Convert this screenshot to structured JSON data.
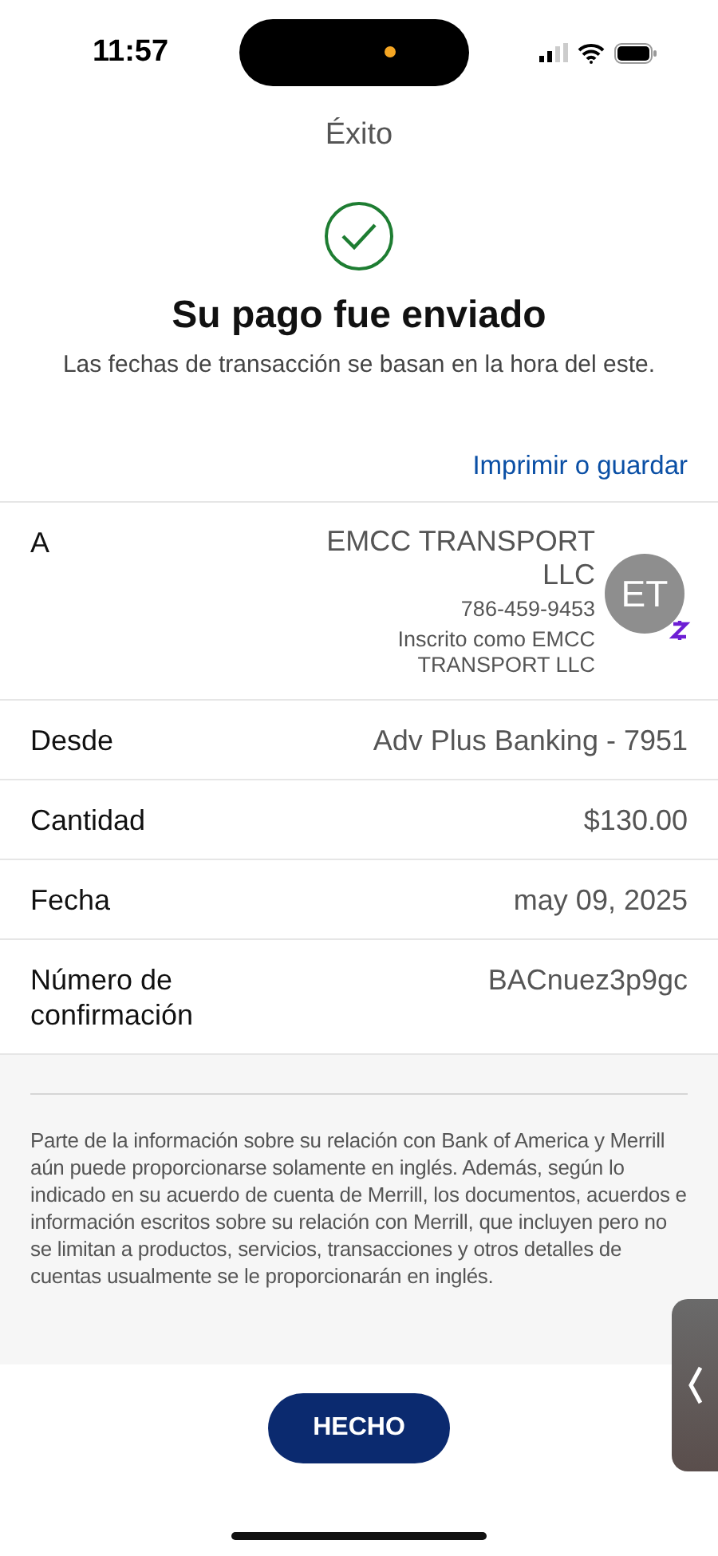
{
  "status_bar": {
    "time": "11:57"
  },
  "header": {
    "title": "Éxito"
  },
  "result": {
    "heading": "Su pago fue enviado",
    "subtitle": "Las fechas de transacción se basan en la hora del este."
  },
  "print_link": "Imprimir o guardar",
  "recipient": {
    "label": "A",
    "name": "EMCC TRANSPORT LLC",
    "phone": "786-459-9453",
    "enrolled": "Inscrito como EMCC TRANSPORT LLC",
    "initials": "ET"
  },
  "details": [
    {
      "label": "Desde",
      "value": "Adv Plus Banking - 7951"
    },
    {
      "label": "Cantidad",
      "value": "$130.00"
    },
    {
      "label": "Fecha",
      "value": "may 09, 2025"
    },
    {
      "label": "Número de confirmación",
      "value": "BACnuez3p9gc"
    }
  ],
  "disclaimer": "Parte de la información sobre su relación con Bank of America y Merrill aún puede proporcionarse solamente en inglés. Además, según lo indicado en su acuerdo de cuenta de Merrill, los documentos, acuerdos e información escritos sobre su relación con Merrill, que incluyen pero no se limitan a productos, servicios, transacciones y otros detalles de cuentas usualmente se le proporcionarán en inglés.",
  "done_button": "HECHO"
}
